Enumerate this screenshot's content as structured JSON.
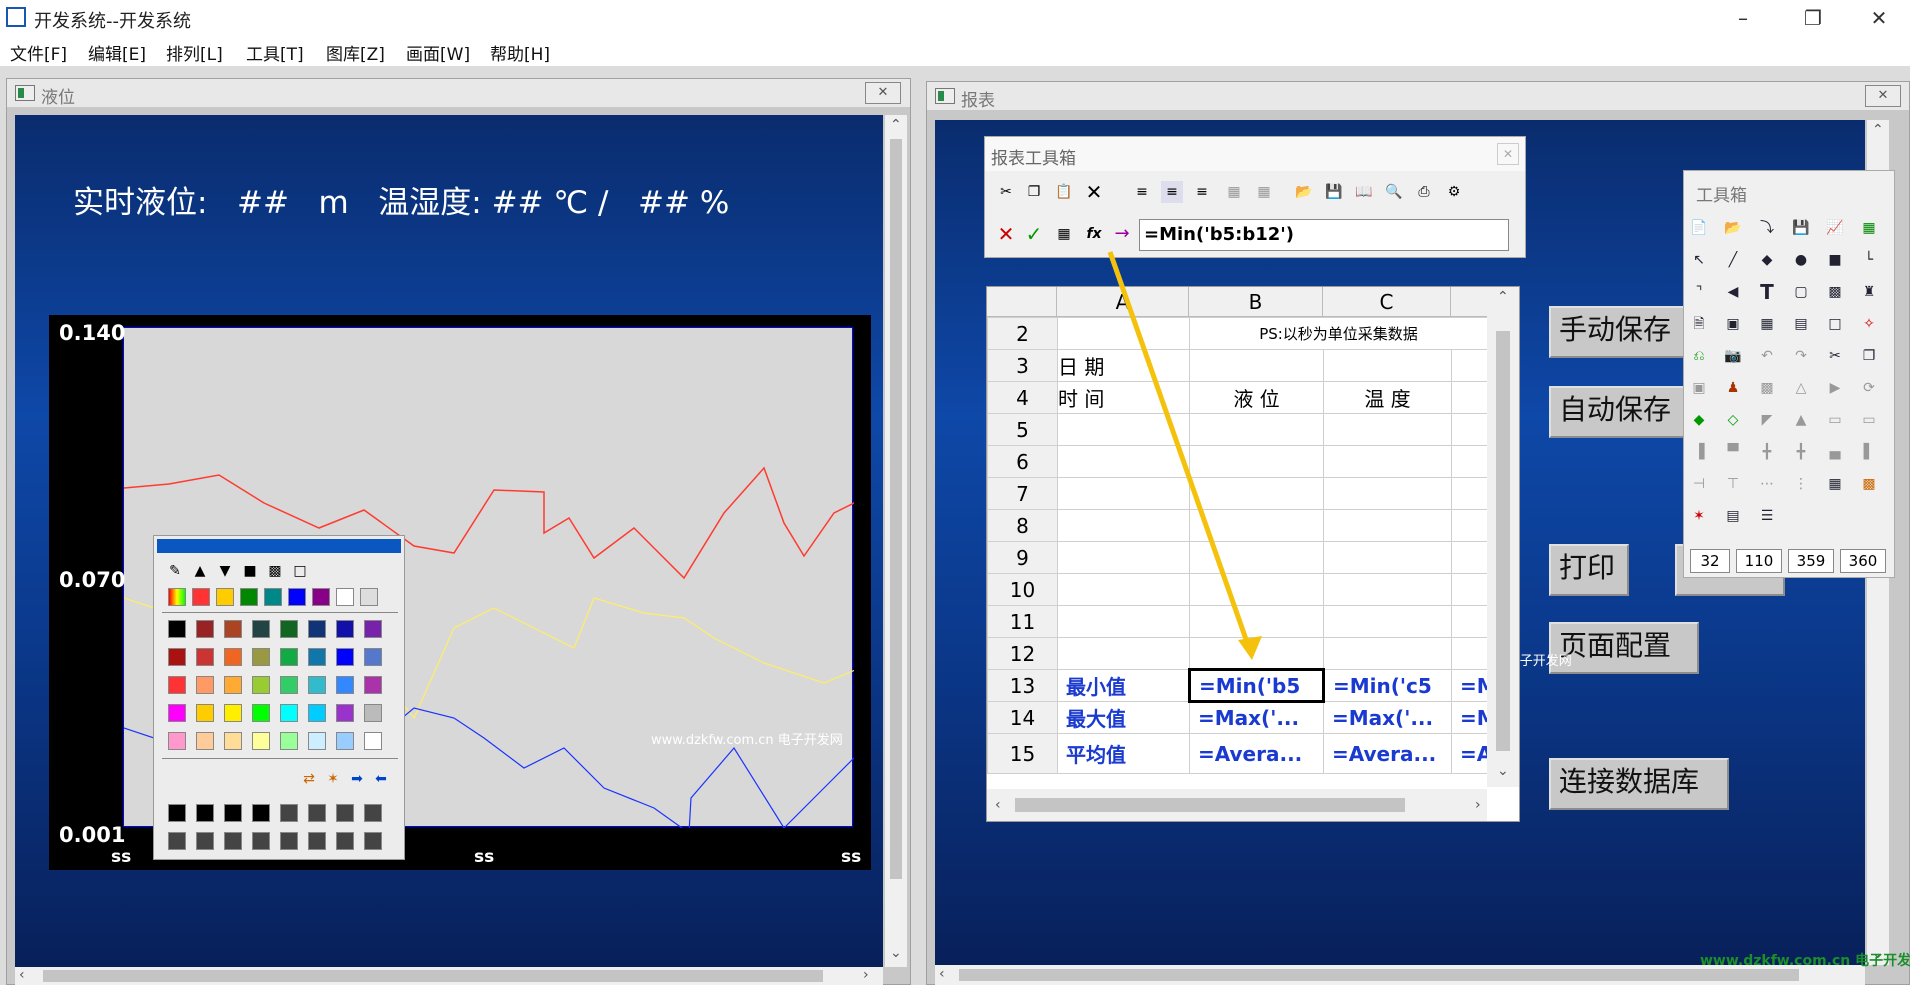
{
  "app": {
    "title": "开发系统--开发系统"
  },
  "menu": [
    "文件[F]",
    "编辑[E]",
    "排列[L]",
    "工具[T]",
    "图库[Z]",
    "画面[W]",
    "帮助[H]"
  ],
  "left_window": {
    "title": "液位",
    "header_text": "实时液位:   ##   m   温湿度: ## ℃ /   ## %",
    "chart": {
      "y_ticks": [
        "0.140",
        "0.070",
        "0.001"
      ],
      "x_ticks": [
        "ss",
        "ss",
        "ss"
      ]
    },
    "watermark": "www.dzkfw.com.cn 电子开发网"
  },
  "right_window": {
    "title": "报表",
    "toolbox_title": "报表工具箱",
    "formula": "=Min('b5:b12')",
    "columns": [
      "A",
      "B",
      "C"
    ],
    "rows": [
      {
        "n": "2",
        "a": "",
        "b": "PS:以秒为单位采集数据",
        "c": "",
        "d": ""
      },
      {
        "n": "3",
        "a": "日 期",
        "b": "",
        "c": "",
        "d": ""
      },
      {
        "n": "4",
        "a": "时 间",
        "b": "液 位",
        "c": "温 度",
        "d": ""
      },
      {
        "n": "5",
        "a": "",
        "b": "",
        "c": "",
        "d": ""
      },
      {
        "n": "6",
        "a": "",
        "b": "",
        "c": "",
        "d": ""
      },
      {
        "n": "7",
        "a": "",
        "b": "",
        "c": "",
        "d": ""
      },
      {
        "n": "8",
        "a": "",
        "b": "",
        "c": "",
        "d": ""
      },
      {
        "n": "9",
        "a": "",
        "b": "",
        "c": "",
        "d": ""
      },
      {
        "n": "10",
        "a": "",
        "b": "",
        "c": "",
        "d": ""
      },
      {
        "n": "11",
        "a": "",
        "b": "",
        "c": "",
        "d": ""
      },
      {
        "n": "12",
        "a": "",
        "b": "",
        "c": "",
        "d": ""
      },
      {
        "n": "13",
        "a": "最小值",
        "b": "=Min('b5",
        "c": "=Min('c5",
        "d": "=M"
      },
      {
        "n": "14",
        "a": "最大值",
        "b": "=Max('...",
        "c": "=Max('...",
        "d": "=M"
      },
      {
        "n": "15",
        "a": "平均值",
        "b": "=Avera...",
        "c": "=Avera...",
        "d": "=A"
      }
    ],
    "buttons": [
      "手动保存",
      "自动保存",
      "打印",
      "页面配置",
      "连接数据库"
    ],
    "watermark": "www.dzkfw.com.cn 电子开发网",
    "tool_palette": {
      "title": "工具箱",
      "coords": [
        "32",
        "110",
        "359",
        "360"
      ]
    },
    "bottom_watermark": "www.dzkfw.com.cn 电子开发网"
  },
  "colors": {
    "accent": "#0a57c2",
    "series_red": "#ff3b30",
    "series_yellow": "#ffee66",
    "series_blue": "#1a33ff"
  }
}
